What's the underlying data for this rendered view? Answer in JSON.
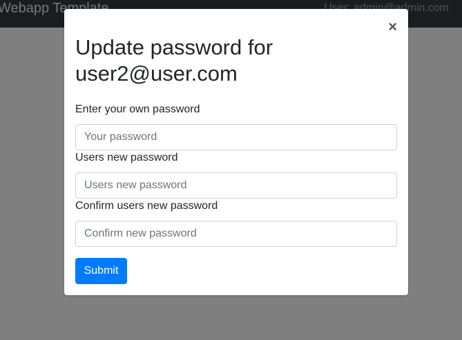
{
  "navbar": {
    "brand": "Webapp Template",
    "user": "User: admin@admin.com"
  },
  "modal": {
    "close_symbol": "×",
    "title": "Update password for user2@user.com",
    "fields": [
      {
        "label": "Enter your own password",
        "placeholder": "Your password",
        "value": ""
      },
      {
        "label": "Users new password",
        "placeholder": "Users new password",
        "value": ""
      },
      {
        "label": "Confirm users new password",
        "placeholder": "Confirm new password",
        "value": ""
      }
    ],
    "submit_label": "Submit"
  },
  "colors": {
    "navbar_bg": "#343a40",
    "primary": "#007bff",
    "backdrop": "rgba(0,0,0,0.5)"
  }
}
